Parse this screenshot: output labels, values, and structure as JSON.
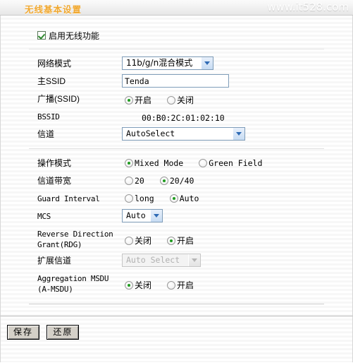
{
  "header": {
    "title": "无线基本设置",
    "watermark": "www.it528.com"
  },
  "form": {
    "enable_wireless": {
      "label": "启用无线功能",
      "checked": true
    },
    "network_mode": {
      "label": "网络模式",
      "value": "11b/g/n混合模式"
    },
    "main_ssid": {
      "label": "主SSID",
      "value": "Tenda",
      "placeholder": ""
    },
    "broadcast_ssid": {
      "label": "广播(SSID)",
      "option_on": "开启",
      "option_off": "关闭",
      "selected": "开启"
    },
    "bssid": {
      "label": "BSSID",
      "value": "00:B0:2C:01:02:10"
    },
    "channel": {
      "label": "信道",
      "value": "AutoSelect"
    },
    "operating_mode": {
      "label": "操作模式",
      "option_mixed": "Mixed Mode",
      "option_green": "Green Field",
      "selected": "Mixed Mode"
    },
    "channel_bandwidth": {
      "label": "信道带宽",
      "option_20": "20",
      "option_2040": "20/40",
      "selected": "20/40"
    },
    "guard_interval": {
      "label": "Guard Interval",
      "option_long": "long",
      "option_auto": "Auto",
      "selected": "Auto"
    },
    "mcs": {
      "label": "MCS",
      "value": "Auto"
    },
    "rdg": {
      "label": "Reverse Direction\nGrant(RDG)",
      "option_off": "关闭",
      "option_on": "开启",
      "selected": "开启"
    },
    "extension_channel": {
      "label": "扩展信道",
      "value": "Auto Select",
      "disabled": true
    },
    "amsdu": {
      "label": "Aggregation MSDU\n(A-MSDU)",
      "option_off": "关闭",
      "option_on": "开启",
      "selected": "关闭"
    }
  },
  "footer": {
    "save_label": "保存",
    "restore_label": "还原"
  },
  "colors": {
    "title_orange": "#f0a830",
    "radio_green": "#1f9b1f",
    "select_border": "#7f9db9"
  }
}
